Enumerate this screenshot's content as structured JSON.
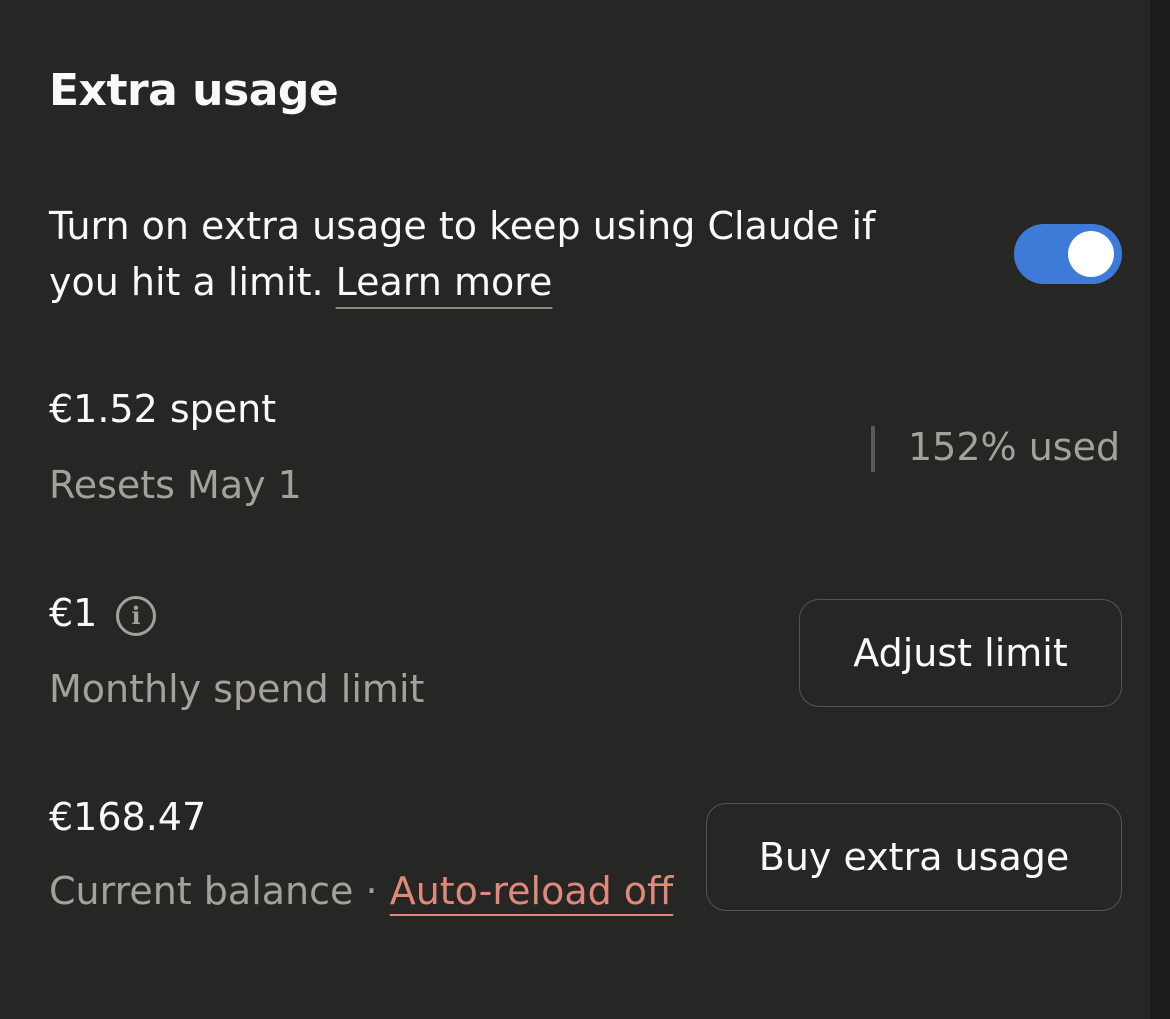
{
  "section": {
    "title": "Extra usage",
    "description": "Turn on extra usage to keep using Claude if you hit a limit.",
    "learn_more": "Learn more",
    "toggle_on": true
  },
  "spent": {
    "amount": "€1.52 spent",
    "resets": "Resets May 1",
    "used": "152% used"
  },
  "limit": {
    "amount": "€1",
    "label": "Monthly spend limit",
    "info_icon": "info-icon",
    "button": "Adjust limit"
  },
  "balance": {
    "amount": "€168.47",
    "label": "Current balance",
    "separator": "·",
    "auto_reload": "Auto-reload off",
    "button": "Buy extra usage"
  },
  "colors": {
    "background": "#262624",
    "toggle_accent": "#3e7bd9",
    "link_warning": "#e0897a"
  }
}
